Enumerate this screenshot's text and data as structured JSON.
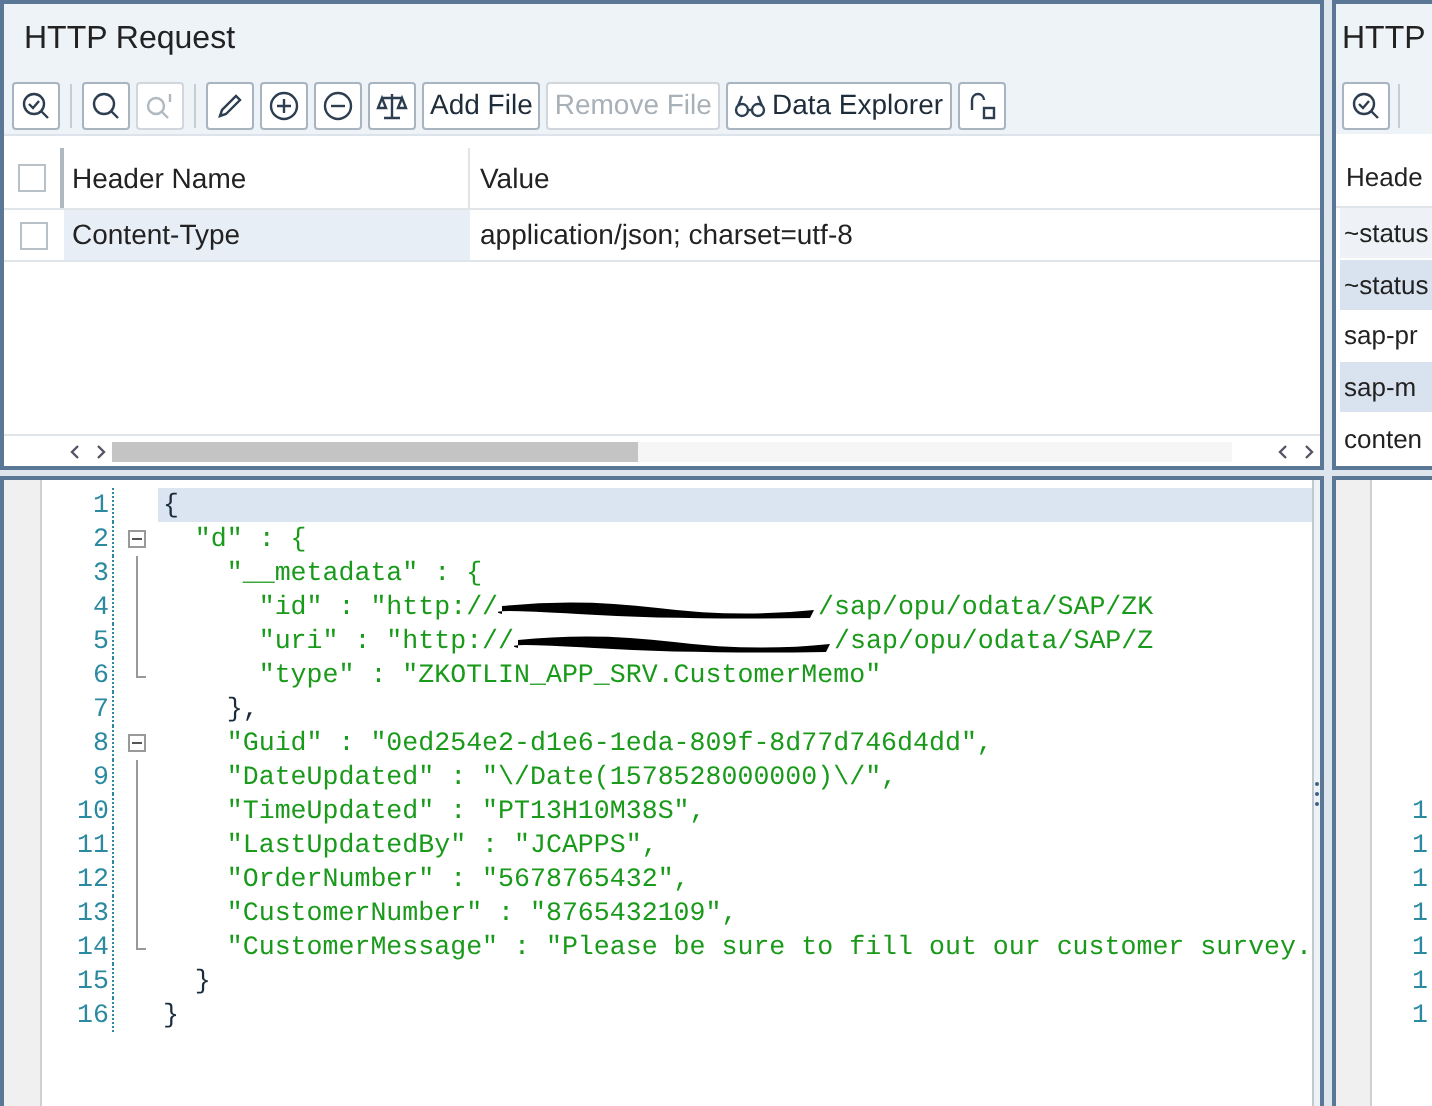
{
  "request_panel": {
    "title": "HTTP Request",
    "toolbar": [
      {
        "kind": "icon",
        "disabled": false,
        "separator_after": true
      },
      {
        "kind": "icon",
        "disabled": false,
        "separator_after": false
      },
      {
        "kind": "icon",
        "disabled": true,
        "separator_after": true
      },
      {
        "kind": "icon",
        "disabled": false,
        "separator_after": false
      },
      {
        "kind": "icon",
        "disabled": false,
        "separator_after": false
      },
      {
        "kind": "icon",
        "disabled": false,
        "separator_after": false
      },
      {
        "kind": "icon",
        "disabled": false,
        "separator_after": false
      },
      {
        "kind": "text",
        "label": "Add File",
        "disabled": false,
        "separator_after": false
      },
      {
        "kind": "text",
        "label": "Remove File",
        "disabled": true,
        "separator_after": false
      },
      {
        "kind": "text",
        "label": "Data Explorer",
        "disabled": false,
        "separator_after": false
      },
      {
        "kind": "icon",
        "disabled": false,
        "separator_after": false
      }
    ],
    "table": {
      "select_all_checked": false,
      "columns": [
        "Header Name",
        "Value"
      ],
      "rows": [
        {
          "checked": false,
          "name": "Content-Type",
          "value": "application/json; charset=utf-8",
          "focused": true
        }
      ]
    },
    "scrollbar": {
      "level": 0.47
    }
  },
  "response_panel": {
    "title": "HTTP",
    "column": "Heade",
    "rows": [
      {
        "name": "~status",
        "selected": false
      },
      {
        "name": "~status",
        "selected": true
      },
      {
        "name": "sap-pr",
        "selected": false
      },
      {
        "name": "sap-m",
        "selected": true
      },
      {
        "name": "conten",
        "selected": false
      }
    ]
  },
  "request_body": {
    "lines": [
      {
        "number": "1",
        "text": "{",
        "current": true,
        "collapsible": false,
        "fold_guide": false,
        "fold_end": false
      },
      {
        "number": "2",
        "text": "  \"d\" : {",
        "current": false,
        "collapsible": true,
        "fold_guide": false,
        "fold_end": false
      },
      {
        "number": "3",
        "text": "    \"__metadata\" : {",
        "current": false,
        "collapsible": false,
        "fold_guide": true,
        "fold_end": false
      },
      {
        "number": "4",
        "text": "      \"id\" : \"http://",
        "redacted": true,
        "text_after": "/sap/opu/odata/SAP/ZK",
        "current": false,
        "collapsible": false,
        "fold_guide": true,
        "fold_end": false
      },
      {
        "number": "5",
        "text": "      \"uri\" : \"http://",
        "redacted": true,
        "text_after": "/sap/opu/odata/SAP/Z",
        "current": false,
        "collapsible": false,
        "fold_guide": true,
        "fold_end": false
      },
      {
        "number": "6",
        "text": "      \"type\" : \"ZKOTLIN_APP_SRV.CustomerMemo\"",
        "current": false,
        "collapsible": false,
        "fold_guide": false,
        "fold_end": true
      },
      {
        "number": "7",
        "text": "    },",
        "current": false,
        "collapsible": false,
        "fold_guide": false,
        "fold_end": false
      },
      {
        "number": "8",
        "text": "    \"Guid\" : \"0ed254e2-d1e6-1eda-809f-8d77d746d4dd\",",
        "current": false,
        "collapsible": true,
        "fold_guide": false,
        "fold_end": false
      },
      {
        "number": "9",
        "text": "    \"DateUpdated\" : \"\\/Date(1578528000000)\\/\",",
        "current": false,
        "collapsible": false,
        "fold_guide": true,
        "fold_end": false
      },
      {
        "number": "10",
        "text": "    \"TimeUpdated\" : \"PT13H10M38S\",",
        "current": false,
        "collapsible": false,
        "fold_guide": true,
        "fold_end": false
      },
      {
        "number": "11",
        "text": "    \"LastUpdatedBy\" : \"JCAPPS\",",
        "current": false,
        "collapsible": false,
        "fold_guide": true,
        "fold_end": false
      },
      {
        "number": "12",
        "text": "    \"OrderNumber\" : \"5678765432\",",
        "current": false,
        "collapsible": false,
        "fold_guide": true,
        "fold_end": false
      },
      {
        "number": "13",
        "text": "    \"CustomerNumber\" : \"8765432109\",",
        "current": false,
        "collapsible": false,
        "fold_guide": true,
        "fold_end": false
      },
      {
        "number": "14",
        "text": "    \"CustomerMessage\" : \"Please be sure to fill out our customer survey.",
        "current": false,
        "collapsible": false,
        "fold_guide": false,
        "fold_end": true
      },
      {
        "number": "15",
        "text": "  }",
        "current": false,
        "collapsible": false,
        "fold_guide": false,
        "fold_end": false
      },
      {
        "number": "16",
        "text": "}",
        "current": false,
        "collapsible": false,
        "fold_guide": false,
        "fold_end": false
      }
    ]
  },
  "response_body": {
    "line_numbers": [
      "1",
      "1",
      "1",
      "1",
      "1",
      "1",
      "1"
    ]
  }
}
